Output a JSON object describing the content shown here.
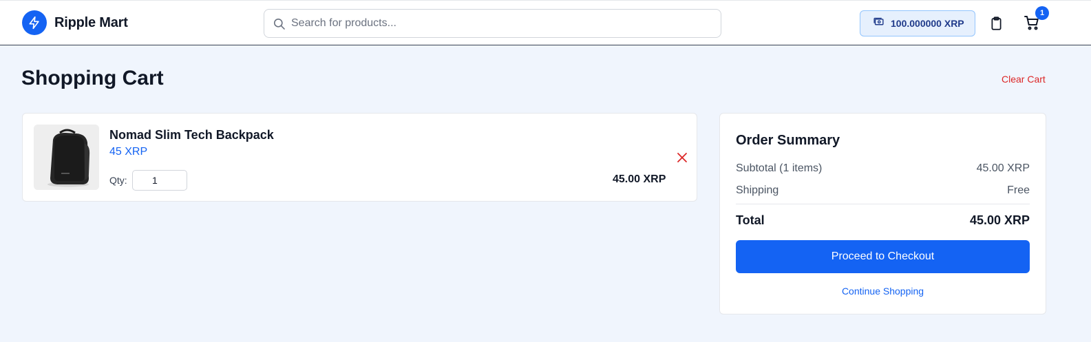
{
  "header": {
    "brand": "Ripple Mart",
    "search_placeholder": "Search for products...",
    "wallet_balance": "100.000000 XRP",
    "cart_count": "1",
    "icons": {
      "logo": "lightning-bolt-icon",
      "search": "search-icon",
      "wallet": "wallet-cash-icon",
      "orders": "clipboard-icon",
      "cart": "shopping-cart-icon"
    }
  },
  "page": {
    "title": "Shopping Cart",
    "clear_cart_label": "Clear Cart"
  },
  "cart": {
    "items": [
      {
        "name": "Nomad Slim Tech Backpack",
        "price": "45 XRP",
        "qty_label": "Qty:",
        "qty": "1",
        "line_total": "45.00 XRP",
        "image": "black-backpack-photo",
        "remove_icon": "close-icon"
      }
    ]
  },
  "summary": {
    "title": "Order Summary",
    "subtotal_label": "Subtotal (1 items)",
    "subtotal_value": "45.00 XRP",
    "shipping_label": "Shipping",
    "shipping_value": "Free",
    "total_label": "Total",
    "total_value": "45.00 XRP",
    "checkout_label": "Proceed to Checkout",
    "continue_label": "Continue Shopping"
  },
  "colors": {
    "accent": "#1463f3",
    "danger": "#dc2626",
    "background": "#f0f5fd"
  }
}
